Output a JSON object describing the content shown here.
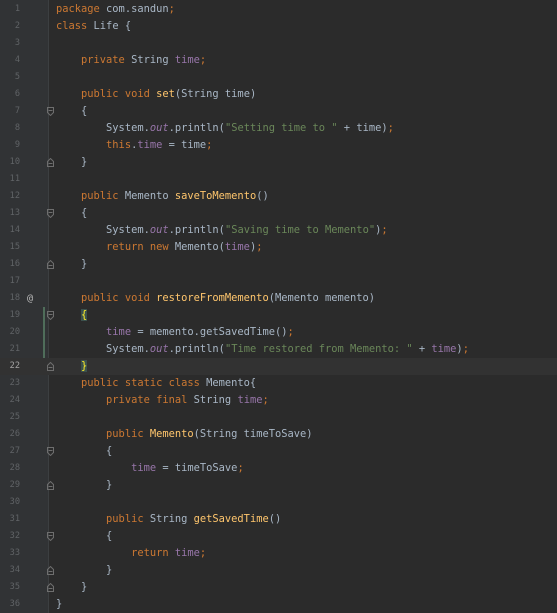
{
  "editor": {
    "lines": [
      {
        "n": "1",
        "tokens": [
          {
            "t": "package ",
            "c": "kw"
          },
          {
            "t": "com.sandun",
            "c": "tx"
          },
          {
            "t": ";",
            "c": "kw"
          }
        ]
      },
      {
        "n": "2",
        "tokens": [
          {
            "t": "class ",
            "c": "kw"
          },
          {
            "t": "Life {",
            "c": "tx"
          }
        ]
      },
      {
        "n": "3",
        "tokens": []
      },
      {
        "n": "4",
        "tokens": [
          {
            "t": "    private ",
            "c": "kw"
          },
          {
            "t": "String ",
            "c": "tx"
          },
          {
            "t": "time",
            "c": "fld"
          },
          {
            "t": ";",
            "c": "kw"
          }
        ]
      },
      {
        "n": "5",
        "tokens": []
      },
      {
        "n": "6",
        "tokens": [
          {
            "t": "    public void ",
            "c": "kw"
          },
          {
            "t": "set",
            "c": "fn"
          },
          {
            "t": "(String time)",
            "c": "tx"
          }
        ]
      },
      {
        "n": "7",
        "fold": "open",
        "tokens": [
          {
            "t": "    {",
            "c": "tx"
          }
        ]
      },
      {
        "n": "8",
        "tokens": [
          {
            "t": "        System.",
            "c": "tx"
          },
          {
            "t": "out",
            "c": "st"
          },
          {
            "t": ".println(",
            "c": "tx"
          },
          {
            "t": "\"Setting time to \"",
            "c": "str"
          },
          {
            "t": " + time)",
            "c": "tx"
          },
          {
            "t": ";",
            "c": "kw"
          }
        ]
      },
      {
        "n": "9",
        "tokens": [
          {
            "t": "        this",
            "c": "kw"
          },
          {
            "t": ".",
            "c": "tx"
          },
          {
            "t": "time",
            "c": "fld"
          },
          {
            "t": " = time",
            "c": "tx"
          },
          {
            "t": ";",
            "c": "kw"
          }
        ]
      },
      {
        "n": "10",
        "fold": "close",
        "tokens": [
          {
            "t": "    }",
            "c": "tx"
          }
        ]
      },
      {
        "n": "11",
        "tokens": []
      },
      {
        "n": "12",
        "tokens": [
          {
            "t": "    public ",
            "c": "kw"
          },
          {
            "t": "Memento ",
            "c": "tx"
          },
          {
            "t": "saveToMemento",
            "c": "fn"
          },
          {
            "t": "()",
            "c": "tx"
          }
        ]
      },
      {
        "n": "13",
        "fold": "open",
        "tokens": [
          {
            "t": "    {",
            "c": "tx"
          }
        ]
      },
      {
        "n": "14",
        "tokens": [
          {
            "t": "        System.",
            "c": "tx"
          },
          {
            "t": "out",
            "c": "st"
          },
          {
            "t": ".println(",
            "c": "tx"
          },
          {
            "t": "\"Saving time to Memento\"",
            "c": "str"
          },
          {
            "t": ")",
            "c": "tx"
          },
          {
            "t": ";",
            "c": "kw"
          }
        ]
      },
      {
        "n": "15",
        "tokens": [
          {
            "t": "        return new ",
            "c": "kw"
          },
          {
            "t": "Memento(",
            "c": "tx"
          },
          {
            "t": "time",
            "c": "fld"
          },
          {
            "t": ")",
            "c": "tx"
          },
          {
            "t": ";",
            "c": "kw"
          }
        ]
      },
      {
        "n": "16",
        "fold": "close",
        "tokens": [
          {
            "t": "    }",
            "c": "tx"
          }
        ]
      },
      {
        "n": "17",
        "tokens": []
      },
      {
        "n": "18",
        "marker": "@",
        "tokens": [
          {
            "t": "    public void ",
            "c": "kw"
          },
          {
            "t": "restoreFromMemento",
            "c": "fn"
          },
          {
            "t": "(Memento memento)",
            "c": "tx"
          }
        ]
      },
      {
        "n": "19",
        "fold": "open",
        "tokens": [
          {
            "t": "    ",
            "c": "tx"
          },
          {
            "t": "{",
            "c": "brmatch"
          }
        ]
      },
      {
        "n": "20",
        "tokens": [
          {
            "t": "        ",
            "c": "tx"
          },
          {
            "t": "time",
            "c": "fld"
          },
          {
            "t": " = memento.getSavedTime()",
            "c": "tx"
          },
          {
            "t": ";",
            "c": "kw"
          }
        ]
      },
      {
        "n": "21",
        "tokens": [
          {
            "t": "        System.",
            "c": "tx"
          },
          {
            "t": "out",
            "c": "st"
          },
          {
            "t": ".println(",
            "c": "tx"
          },
          {
            "t": "\"Time restored from Memento: \"",
            "c": "str"
          },
          {
            "t": " + ",
            "c": "tx"
          },
          {
            "t": "time",
            "c": "fld"
          },
          {
            "t": ")",
            "c": "tx"
          },
          {
            "t": ";",
            "c": "kw"
          }
        ]
      },
      {
        "n": "22",
        "current": true,
        "fold": "close",
        "tokens": [
          {
            "t": "    ",
            "c": "tx"
          },
          {
            "t": "}",
            "c": "brmatch"
          }
        ]
      },
      {
        "n": "23",
        "tokens": [
          {
            "t": "    public static class ",
            "c": "kw"
          },
          {
            "t": "Memento{",
            "c": "tx"
          }
        ]
      },
      {
        "n": "24",
        "tokens": [
          {
            "t": "        private final ",
            "c": "kw"
          },
          {
            "t": "String ",
            "c": "tx"
          },
          {
            "t": "time",
            "c": "fld"
          },
          {
            "t": ";",
            "c": "kw"
          }
        ]
      },
      {
        "n": "25",
        "tokens": []
      },
      {
        "n": "26",
        "tokens": [
          {
            "t": "        public ",
            "c": "kw"
          },
          {
            "t": "Memento",
            "c": "fn"
          },
          {
            "t": "(String timeToSave)",
            "c": "tx"
          }
        ]
      },
      {
        "n": "27",
        "fold": "open",
        "tokens": [
          {
            "t": "        {",
            "c": "tx"
          }
        ]
      },
      {
        "n": "28",
        "tokens": [
          {
            "t": "            ",
            "c": "tx"
          },
          {
            "t": "time",
            "c": "fld"
          },
          {
            "t": " = timeToSave",
            "c": "tx"
          },
          {
            "t": ";",
            "c": "kw"
          }
        ]
      },
      {
        "n": "29",
        "fold": "close",
        "tokens": [
          {
            "t": "        }",
            "c": "tx"
          }
        ]
      },
      {
        "n": "30",
        "tokens": []
      },
      {
        "n": "31",
        "tokens": [
          {
            "t": "        public ",
            "c": "kw"
          },
          {
            "t": "String ",
            "c": "tx"
          },
          {
            "t": "getSavedTime",
            "c": "fn"
          },
          {
            "t": "()",
            "c": "tx"
          }
        ]
      },
      {
        "n": "32",
        "fold": "open",
        "tokens": [
          {
            "t": "        {",
            "c": "tx"
          }
        ]
      },
      {
        "n": "33",
        "tokens": [
          {
            "t": "            return ",
            "c": "kw"
          },
          {
            "t": "time",
            "c": "fld"
          },
          {
            "t": ";",
            "c": "kw"
          }
        ]
      },
      {
        "n": "34",
        "fold": "close",
        "tokens": [
          {
            "t": "        }",
            "c": "tx"
          }
        ]
      },
      {
        "n": "35",
        "fold": "close",
        "tokens": [
          {
            "t": "    }",
            "c": "tx"
          }
        ]
      },
      {
        "n": "36",
        "tokens": [
          {
            "t": "}",
            "c": "tx"
          }
        ]
      }
    ]
  },
  "colors": {
    "background": "#2b2b2b",
    "gutter": "#313335",
    "keyword": "#cc7832",
    "field": "#9876aa",
    "method": "#ffc66d",
    "string": "#6a8759",
    "text": "#a9b7c6",
    "line_number": "#606366",
    "brace_match": "#ffef28"
  }
}
